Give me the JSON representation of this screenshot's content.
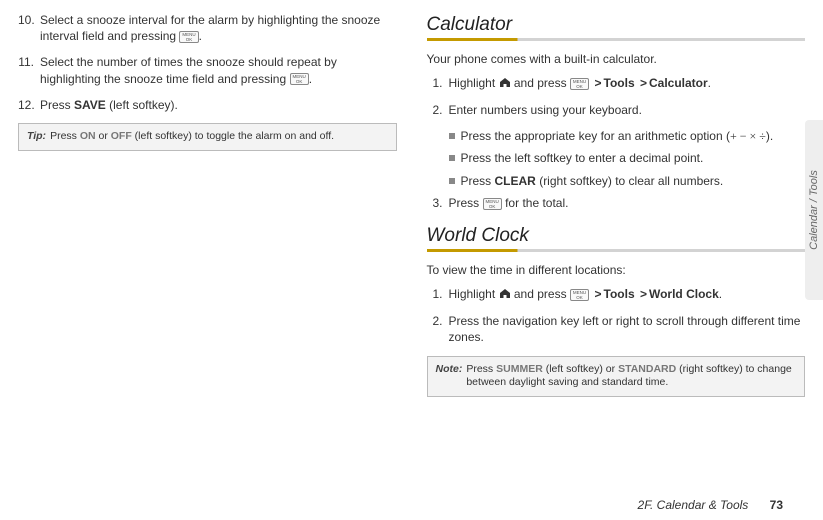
{
  "left": {
    "items": [
      {
        "num": "10.",
        "text_a": "Select a snooze interval for the alarm by highlighting the snooze interval field and pressing ",
        "text_b": "."
      },
      {
        "num": "11.",
        "text_a": "Select the number of times the snooze should repeat by highlighting the snooze time field and pressing ",
        "text_b": "."
      },
      {
        "num": "12.",
        "text_a": "Press ",
        "bold": "SAVE",
        "text_b": " (left softkey)."
      }
    ],
    "tip": {
      "label": "Tip:",
      "t1": "Press ",
      "b1": "ON",
      "t2": " or ",
      "b2": "OFF",
      "t3": " (left softkey) to toggle the alarm on and off."
    }
  },
  "right": {
    "calc": {
      "title": "Calculator",
      "intro": "Your phone comes with a built-in calculator.",
      "steps": [
        {
          "num": "1.",
          "pre": "Highlight ",
          "mid": " and press ",
          "gt1": ">",
          "b1": "Tools",
          "gt2": ">",
          "b2": "Calculator",
          "post": "."
        },
        {
          "num": "2.",
          "text": "Enter numbers using your keyboard."
        }
      ],
      "subs": [
        {
          "t1": "Press the appropriate key for an arithmetic option (",
          "ops": "+ − × ÷",
          "t2": ")."
        },
        {
          "t1": "Press the left softkey to enter a decimal point."
        },
        {
          "t1": "Press ",
          "b1": "CLEAR",
          "t2": " (right softkey) to clear all numbers."
        }
      ],
      "step3": {
        "num": "3.",
        "t1": "Press ",
        "t2": " for the total."
      }
    },
    "wc": {
      "title": "World Clock",
      "intro": "To view the time in different locations:",
      "steps": [
        {
          "num": "1.",
          "pre": "Highlight ",
          "mid": " and press ",
          "gt1": ">",
          "b1": "Tools",
          "gt2": ">",
          "b2": "World Clock",
          "post": "."
        },
        {
          "num": "2.",
          "text": "Press the navigation key left or right to scroll through different time zones."
        }
      ],
      "note": {
        "label": "Note:",
        "t1": "Press ",
        "b1": "SUMMER",
        "t2": " (left softkey) or ",
        "b2": "STANDARD",
        "t3": " (right softkey) to change between daylight saving and standard time."
      }
    }
  },
  "sidetab": "Calendar / Tools",
  "footer": {
    "section": "2F. Calendar & Tools",
    "page": "73"
  }
}
